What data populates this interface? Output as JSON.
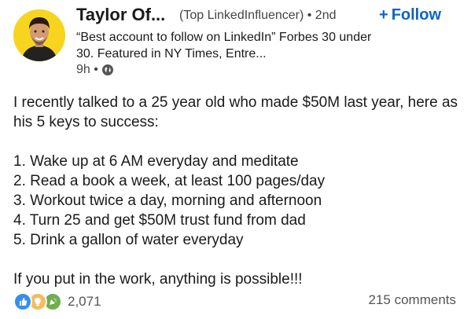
{
  "author": {
    "name": "Taylor Of...",
    "meta": "(Top LinkedInfluencer) • 2nd",
    "headline": "“Best account to follow on LinkedIn” Forbes 30 under 30. Featured in NY Times, Entre...",
    "time": "9h •",
    "visibility_icon": "globe-icon"
  },
  "follow": {
    "label": "Follow",
    "plus": "+"
  },
  "post": {
    "intro": "I recently talked to a 25 year old who made $50M last year, here as his 5 keys to success:",
    "list": [
      "1. Wake up at 6 AM everyday and meditate",
      "2. Read a book a week, at least 100 pages/day",
      "3. Workout twice a day, morning and afternoon",
      "4. Turn 25 and get $50M trust fund from dad",
      "5. Drink a gallon of water everyday"
    ],
    "closing": "If you put in the work, anything is possible!!!"
  },
  "social": {
    "reaction_icons": [
      "like-icon",
      "insightful-icon",
      "celebrate-icon"
    ],
    "reaction_count": "2,071",
    "comments": "215 comments"
  },
  "colors": {
    "accent": "#0a66c2",
    "avatar_bg": "#f7d51f",
    "like": "#378fe9",
    "insightful": "#f5bb5c",
    "celebrate": "#6dae4f"
  }
}
